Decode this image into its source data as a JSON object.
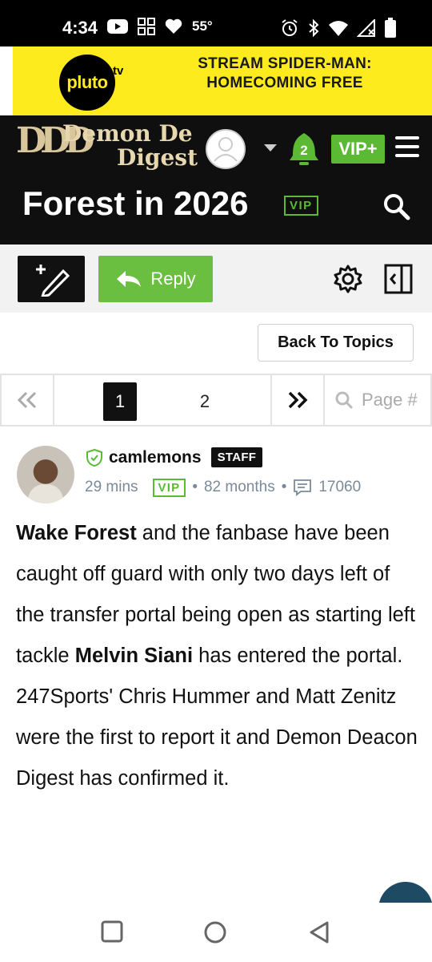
{
  "status_bar": {
    "time": "4:34",
    "temperature": "55°",
    "icons": [
      "youtube-icon",
      "app-grid-icon",
      "heart-icon",
      "alarm-icon",
      "bluetooth-icon",
      "wifi-icon",
      "signal-icon",
      "battery-icon"
    ]
  },
  "ad": {
    "brand": "pluto",
    "brand_suffix": "tv",
    "text": "STREAM SPIDER-MAN: HOMECOMING FREE",
    "colors": {
      "background": "#fdeb1d",
      "logo": "#000000"
    }
  },
  "site": {
    "logo_monogram": "DDD",
    "logo_line1": "Demon De",
    "logo_line2": "Digest",
    "notification_count": "2",
    "vip_plus_label": "VIP+",
    "page_title": "Forest in 2026",
    "title_badge": "VIP",
    "colors": {
      "header_bg": "#0f0f0f",
      "accent_green": "#5cb934",
      "logo_gold": "#e6d7ae"
    }
  },
  "toolbar": {
    "reply_label": "Reply",
    "back_to_topics_label": "Back To Topics"
  },
  "pagination": {
    "pages": [
      "1",
      "2"
    ],
    "current_page": "1",
    "page_input_placeholder": "Page #"
  },
  "post": {
    "username": "camlemons",
    "role_badge": "STAFF",
    "time_ago": "29 mins",
    "vip_badge": "VIP",
    "membership": "82 months",
    "post_count": "17060",
    "body": [
      {
        "text": "Wake Forest",
        "bold": true
      },
      {
        "text": " and the fanbase have been caught off guard with only two days left of the transfer portal being open as starting left tackle ",
        "bold": false
      },
      {
        "text": "Melvin Siani",
        "bold": true
      },
      {
        "text": " has entered the portal. 247Sports' Chris Hummer and Matt Zenitz were the first to report it and Demon Deacon Digest has confirmed it.",
        "bold": false
      }
    ]
  }
}
